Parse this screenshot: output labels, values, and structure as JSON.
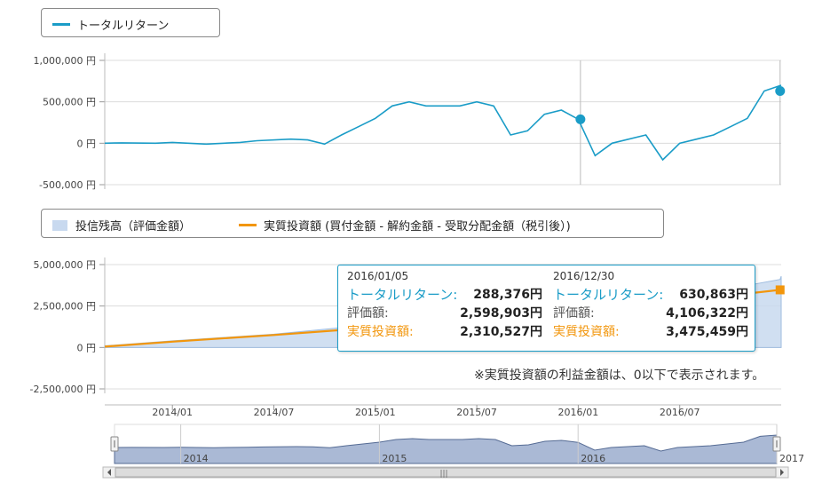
{
  "legend_top": {
    "items": [
      {
        "label": "トータルリターン",
        "color": "#1a9cc7"
      }
    ]
  },
  "legend_bottom": {
    "items": [
      {
        "label": "投信残高（評価金額）",
        "color": "#c8d9ef"
      },
      {
        "label": "実質投資額 (買付金額 - 解約金額 - 受取分配金額（税引後）)",
        "color": "#f2960c"
      }
    ]
  },
  "tooltip": {
    "columns": [
      {
        "date": "2016/01/05",
        "rows": [
          {
            "key": "トータルリターン:",
            "value": "288,376円"
          },
          {
            "key": "評価額:",
            "value": "2,598,903円"
          },
          {
            "key": "実質投資額:",
            "value": "2,310,527円"
          }
        ]
      },
      {
        "date": "2016/12/30",
        "rows": [
          {
            "key": "トータルリターン:",
            "value": "630,863円"
          },
          {
            "key": "評価額:",
            "value": "4,106,322円"
          },
          {
            "key": "実質投資額:",
            "value": "3,475,459円"
          }
        ]
      }
    ]
  },
  "note": "※実質投資額の利益金額は、0以下で表示されます。",
  "x_axis": {
    "ticks": [
      "2014/01",
      "2014/07",
      "2015/01",
      "2015/07",
      "2016/01",
      "2016/07"
    ]
  },
  "navigator": {
    "year_labels": [
      "2014",
      "2015",
      "2016",
      "2017"
    ],
    "scroll_grip": "|||"
  },
  "chart_data": [
    {
      "type": "line",
      "x_start": "2013/09",
      "x_end": "2017/01",
      "yticks": [
        "1,000,000 円",
        "500,000 円",
        "0 円",
        "-500,000 円"
      ],
      "ylim": [
        -500000,
        1000000
      ],
      "grid": true,
      "series": [
        {
          "name": "トータルリターン",
          "color": "#1a9cc7",
          "x": [
            "2013/09",
            "2013/10",
            "2013/12",
            "2014/01",
            "2014/03",
            "2014/05",
            "2014/06",
            "2014/08",
            "2014/09",
            "2014/10",
            "2014/11",
            "2014/12",
            "2015/01",
            "2015/02",
            "2015/03",
            "2015/04",
            "2015/06",
            "2015/07",
            "2015/08",
            "2015/09",
            "2015/10",
            "2015/11",
            "2015/12",
            "2016/01",
            "2016/02",
            "2016/03",
            "2016/05",
            "2016/06",
            "2016/07",
            "2016/08",
            "2016/09",
            "2016/10",
            "2016/11",
            "2016/12",
            "2017/01"
          ],
          "values": [
            0,
            5000,
            0,
            10000,
            -10000,
            10000,
            30000,
            50000,
            40000,
            -10000,
            100000,
            200000,
            300000,
            450000,
            500000,
            450000,
            450000,
            500000,
            450000,
            100000,
            150000,
            350000,
            400000,
            290000,
            -150000,
            0,
            100000,
            -200000,
            0,
            50000,
            100000,
            200000,
            300000,
            630000,
            700000
          ]
        }
      ],
      "markers": [
        {
          "x": "2016/01/05",
          "value": 288376
        },
        {
          "x": "2016/12/30",
          "value": 630863
        }
      ]
    },
    {
      "type": "area",
      "x_start": "2013/09",
      "x_end": "2017/01",
      "yticks": [
        "5,000,000 円",
        "2,500,000 円",
        "0 円",
        "-2,500,000 円"
      ],
      "ylim": [
        -2500000,
        5000000
      ],
      "grid": true,
      "series": [
        {
          "name": "投信残高（評価金額）",
          "color": "#c8d9ef",
          "x": [
            "2013/09",
            "2014/01",
            "2014/07",
            "2015/01",
            "2015/07",
            "2016/01",
            "2016/07",
            "2016/12/30",
            "2017/01"
          ],
          "values": [
            100000,
            400000,
            800000,
            1400000,
            1800000,
            2598903,
            3000000,
            4106322,
            4300000
          ]
        },
        {
          "name": "実質投資額",
          "color": "#f2960c",
          "x": [
            "2013/09",
            "2014/01",
            "2014/07",
            "2015/01",
            "2015/07",
            "2016/01",
            "2016/07",
            "2016/12/30",
            "2017/01"
          ],
          "values": [
            50000,
            350000,
            750000,
            1200000,
            1700000,
            2310527,
            2800000,
            3475459,
            3600000
          ]
        }
      ]
    }
  ]
}
